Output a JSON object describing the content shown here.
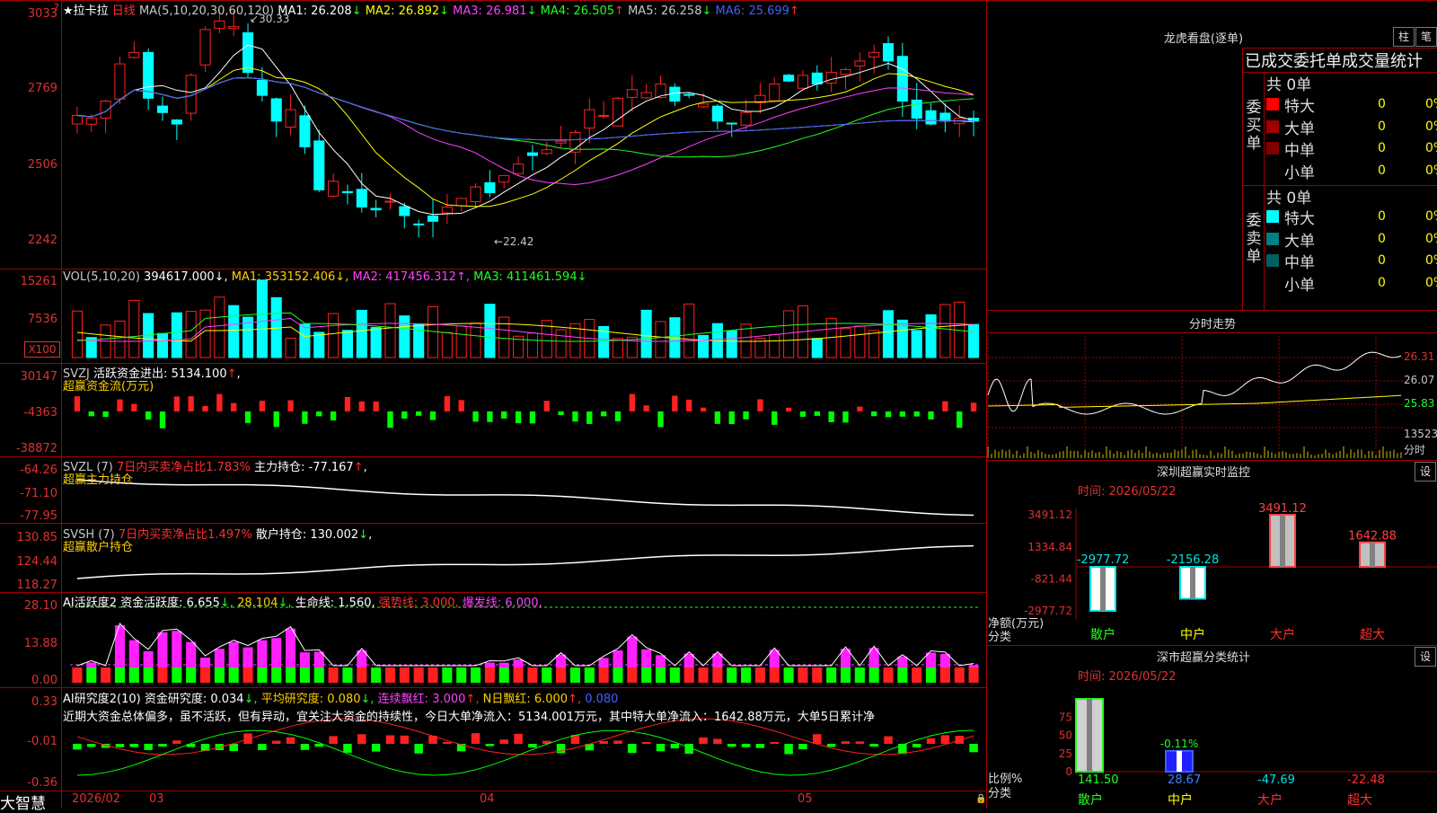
{
  "stock": {
    "name": "★拉卡拉",
    "period": "日线"
  },
  "brand": "大智慧",
  "colors": {
    "up": "#ff2020",
    "down": "#00ffff",
    "grid": "#a00000"
  },
  "main": {
    "ma_title": "MA(5,10,20,30,60,120)",
    "ma": [
      {
        "label": "MA1:",
        "value": "26.208",
        "arrow": "↓",
        "color": "#ffffff"
      },
      {
        "label": "MA2:",
        "value": "26.892",
        "arrow": "↓",
        "color": "#ffff00"
      },
      {
        "label": "MA3:",
        "value": "26.981",
        "arrow": "↓",
        "color": "#ff40ff"
      },
      {
        "label": "MA4:",
        "value": "26.505",
        "arrow": "↑",
        "color": "#20ff20"
      },
      {
        "label": "MA5:",
        "value": "26.258",
        "arrow": "↓",
        "color": "#c8c8c8"
      },
      {
        "label": "MA6:",
        "value": "25.699",
        "arrow": "↑",
        "color": "#4060ff"
      }
    ],
    "y_labels": [
      "3033",
      "2769",
      "2506",
      "2242"
    ],
    "high_mark": "30.33",
    "low_mark": "22.42"
  },
  "volume": {
    "title": "VOL(5,10,20)",
    "value": "394617.000",
    "ma1": "353152.406",
    "ma2": "417456.312",
    "ma3": "411461.594",
    "y_labels": [
      "15261",
      "7536"
    ],
    "unit": "X100"
  },
  "svzj": {
    "title": "SVZJ",
    "line1_label": "活跃资金进出:",
    "line1_value": "5134.100",
    "subtitle": "超赢资金流(万元)",
    "y_labels": [
      "30147",
      "-4363",
      "-38872"
    ]
  },
  "svzl": {
    "title": "SVZL (7)",
    "ratio": "7日内买卖净占比1.783%",
    "pos_label": "主力持仓:",
    "pos_value": "-77.167",
    "subtitle": "超赢主力持仓",
    "y_labels": [
      "-64.26",
      "-71.10",
      "-77.95"
    ]
  },
  "svsh": {
    "title": "SVSH (7)",
    "ratio": "7日内买卖净占比1.497%",
    "pos_label": "散户持仓:",
    "pos_value": "130.002",
    "subtitle": "超赢散户持仓",
    "y_labels": [
      "130.85",
      "124.44",
      "118.27"
    ]
  },
  "ai_active": {
    "title": "AI活跃度2",
    "act_label": "资金活跃度:",
    "act_value": "6.655",
    "v2": "28.104",
    "life_label": "生命线:",
    "life_value": "1.560",
    "strong_label": "强势线:",
    "strong_value": "3.000",
    "burst_label": "爆发线:",
    "burst_value": "6.000",
    "y_labels": [
      "28.10",
      "13.88",
      "0.00"
    ]
  },
  "ai_research": {
    "title": "AI研究度2(10)",
    "res_label": "资金研究度:",
    "res_value": "0.034",
    "avg_label": "平均研究度:",
    "avg_value": "0.080",
    "cont_label": "连续飘红:",
    "cont_value": "3.000",
    "n_label": "N日飘红:",
    "n_value": "6.000",
    "extra": "0.080",
    "comment": "近期大资金总体偏多，虽不活跃，但有异动，宜关注大资金的持续性，今日大单净流入：5134.001万元，其中特大单净流入：1642.88万元，大单5日累计净",
    "y_labels": [
      "0.33",
      "-0.01",
      "-0.36"
    ]
  },
  "x_axis": {
    "labels": [
      "2026/02",
      "03",
      "04",
      "05"
    ]
  },
  "right": {
    "dragon": {
      "title": "龙虎看盘(逐单)",
      "btn1": "柱",
      "btn2": "笔",
      "header": "已成交委托单成交量统计"
    },
    "buy": {
      "side_label": "委买单",
      "count": "共 0单",
      "rows": [
        {
          "name": "特大",
          "value": "0",
          "pct": "0%",
          "color": "#ff0000"
        },
        {
          "name": "大单",
          "value": "0",
          "pct": "0%",
          "color": "#a00000"
        },
        {
          "name": "中单",
          "value": "0",
          "pct": "0%",
          "color": "#800000"
        },
        {
          "name": "小单",
          "value": "0",
          "pct": "0%",
          "color": "#000000"
        }
      ]
    },
    "sell": {
      "side_label": "委卖单",
      "count": "共 0单",
      "rows": [
        {
          "name": "特大",
          "value": "0",
          "pct": "0%",
          "color": "#00ffff"
        },
        {
          "name": "大单",
          "value": "0",
          "pct": "0%",
          "color": "#008080"
        },
        {
          "name": "中单",
          "value": "0",
          "pct": "0%",
          "color": "#006060"
        },
        {
          "name": "小单",
          "value": "0",
          "pct": "0%",
          "color": "#000000"
        }
      ]
    },
    "intraday": {
      "title": "分时走势",
      "y_labels": [
        "26.31",
        "26.07",
        "25.83"
      ],
      "vol_label": "13523",
      "tag": "分时"
    },
    "monitor": {
      "title": "深圳超赢实时监控",
      "btn": "设",
      "time": "时间: 2026/05/22",
      "y_labels": [
        "3491.12",
        "1334.84",
        "-821.44",
        "-2977.72"
      ],
      "axis_label": "净额(万元)",
      "cat_label": "分类",
      "categories": [
        "散户",
        "中户",
        "大户",
        "超大"
      ],
      "values": [
        -2977.72,
        -2156.28,
        3491.12,
        1642.88
      ],
      "value_labels": [
        "-2977.72",
        "-2156.28",
        "3491.12",
        "1642.88"
      ]
    },
    "class_stat": {
      "title": "深市超赢分类统计",
      "btn": "设",
      "time": "时间: 2026/05/22",
      "y_labels": [
        "75",
        "50",
        "25",
        "0"
      ],
      "axis_label": "比例%",
      "cat_label": "分类",
      "categories": [
        "散户",
        "中户",
        "大户",
        "超大"
      ],
      "values": [
        141.5,
        28.67,
        -47.69,
        -22.48
      ],
      "value_labels": [
        "141.50",
        "28.67",
        "-47.69",
        "-22.48"
      ],
      "bar_label": "-0.11%"
    }
  }
}
